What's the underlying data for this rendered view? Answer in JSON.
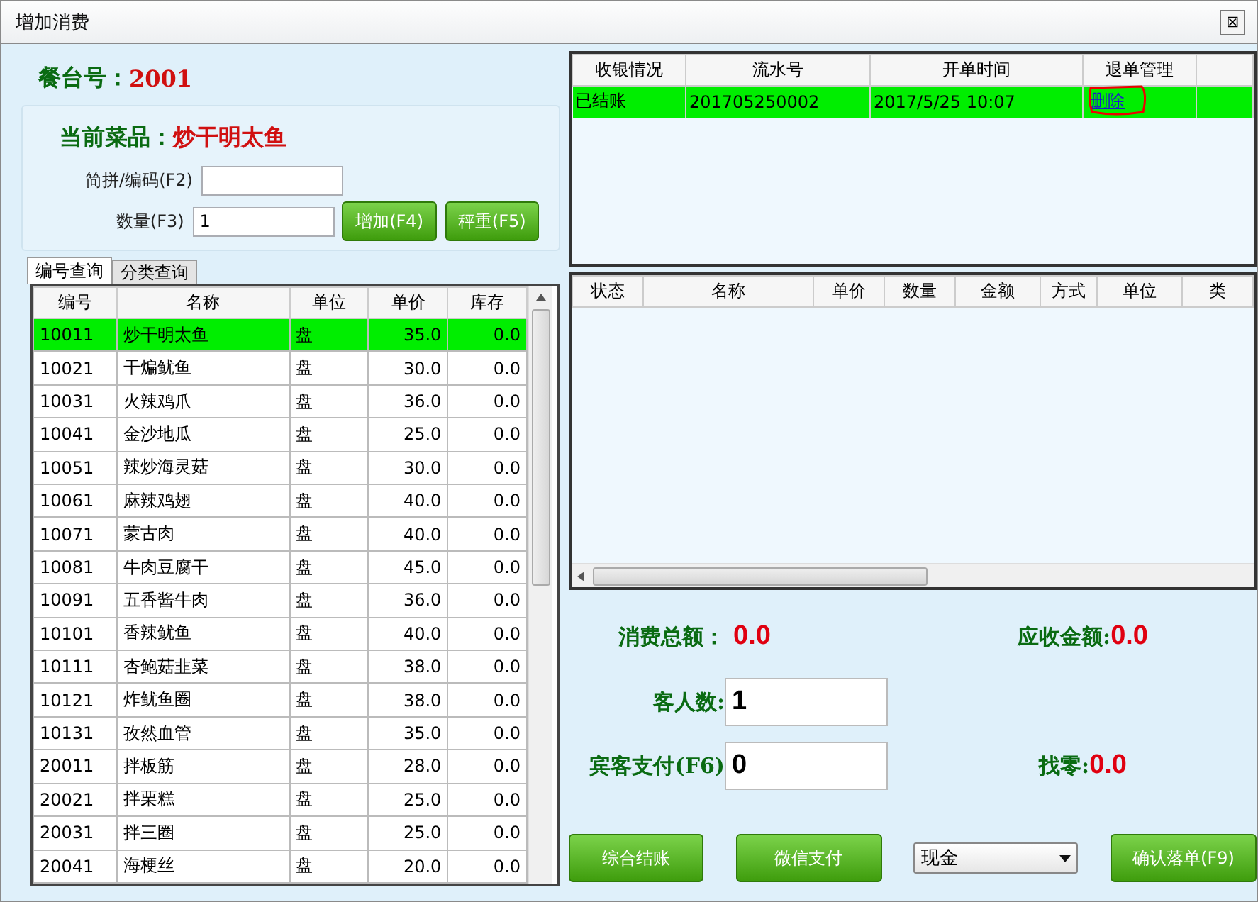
{
  "window": {
    "title": "增加消费",
    "close": "⊠"
  },
  "table_number": {
    "label": "餐台号：",
    "value": "2001"
  },
  "current_dish": {
    "label": "当前菜品：",
    "value": "炒干明太鱼"
  },
  "code_field": {
    "label": "简拼/编码(F2)"
  },
  "qty_field": {
    "label": "数量(F3)",
    "value": "1"
  },
  "dish_buttons": [
    "增加(F4)",
    "秤重(F5)"
  ],
  "tabs": [
    {
      "label": "编号查询",
      "selected": true
    },
    {
      "label": "分类查询",
      "selected": false
    }
  ],
  "menu_table": {
    "columns": [
      "编号",
      "名称",
      "单位",
      "单价",
      "库存"
    ],
    "rows": [
      {
        "cells": [
          "10011",
          "炒干明太鱼",
          "盘",
          "35.0",
          "0.0"
        ],
        "selected": true
      },
      {
        "cells": [
          "10021",
          "干煸鱿鱼",
          "盘",
          "30.0",
          "0.0"
        ],
        "selected": false
      },
      {
        "cells": [
          "10031",
          "火辣鸡爪",
          "盘",
          "36.0",
          "0.0"
        ],
        "selected": false
      },
      {
        "cells": [
          "10041",
          "金沙地瓜",
          "盘",
          "25.0",
          "0.0"
        ],
        "selected": false
      },
      {
        "cells": [
          "10051",
          "辣炒海灵菇",
          "盘",
          "30.0",
          "0.0"
        ],
        "selected": false
      },
      {
        "cells": [
          "10061",
          "麻辣鸡翅",
          "盘",
          "40.0",
          "0.0"
        ],
        "selected": false
      },
      {
        "cells": [
          "10071",
          "蒙古肉",
          "盘",
          "40.0",
          "0.0"
        ],
        "selected": false
      },
      {
        "cells": [
          "10081",
          "牛肉豆腐干",
          "盘",
          "45.0",
          "0.0"
        ],
        "selected": false
      },
      {
        "cells": [
          "10091",
          "五香酱牛肉",
          "盘",
          "36.0",
          "0.0"
        ],
        "selected": false
      },
      {
        "cells": [
          "10101",
          "香辣鱿鱼",
          "盘",
          "40.0",
          "0.0"
        ],
        "selected": false
      },
      {
        "cells": [
          "10111",
          "杏鲍菇韭菜",
          "盘",
          "38.0",
          "0.0"
        ],
        "selected": false
      },
      {
        "cells": [
          "10121",
          "炸鱿鱼圈",
          "盘",
          "38.0",
          "0.0"
        ],
        "selected": false
      },
      {
        "cells": [
          "10131",
          "孜然血管",
          "盘",
          "35.0",
          "0.0"
        ],
        "selected": false
      },
      {
        "cells": [
          "20011",
          "拌板筋",
          "盘",
          "28.0",
          "0.0"
        ],
        "selected": false
      },
      {
        "cells": [
          "20021",
          "拌栗糕",
          "盘",
          "25.0",
          "0.0"
        ],
        "selected": false
      },
      {
        "cells": [
          "20031",
          "拌三圈",
          "盘",
          "25.0",
          "0.0"
        ],
        "selected": false
      },
      {
        "cells": [
          "20041",
          "海梗丝",
          "盘",
          "20.0",
          "0.0"
        ],
        "selected": false
      }
    ]
  },
  "bill_table": {
    "columns": [
      "收银情况",
      "流水号",
      "开单时间",
      "退单管理"
    ],
    "rows": [
      {
        "cells": [
          "已结账",
          "201705250002",
          "2017/5/25 10:07"
        ],
        "action": "删除",
        "selected": true
      }
    ]
  },
  "detail_table": {
    "columns": [
      "状态",
      "名称",
      "单价",
      "数量",
      "金额",
      "方式",
      "单位",
      "类"
    ]
  },
  "summary": {
    "total": {
      "label": "消费总额：",
      "value": "0.0"
    },
    "receivable": {
      "label": "应收金额:",
      "value": "0.0"
    },
    "guests": {
      "label": "客人数:",
      "value": "1"
    },
    "payment": {
      "label": "宾客支付(F6)",
      "value": "0"
    },
    "change": {
      "label": "找零:",
      "value": "0.0"
    }
  },
  "footer_buttons": [
    "综合结账",
    "微信支付"
  ],
  "payment_method": "现金",
  "confirm_button": "确认落单(F9)"
}
